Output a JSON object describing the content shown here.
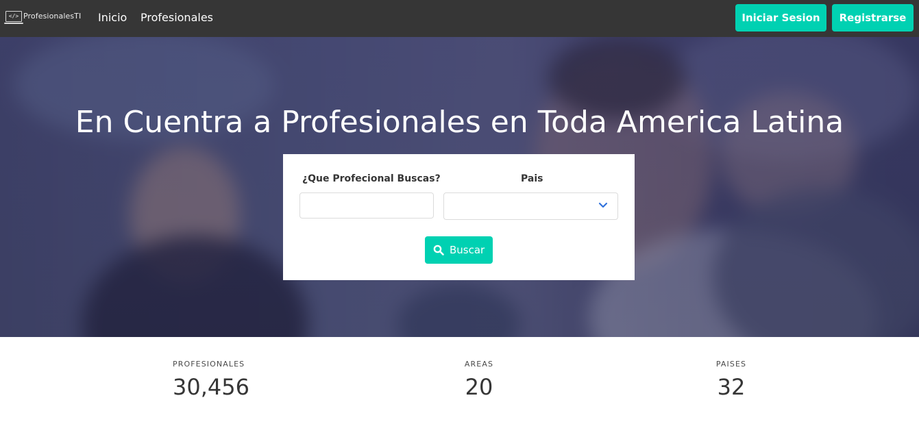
{
  "navbar": {
    "logo_text": "ProfesionalesTI",
    "logo_glyph": "</>",
    "links": [
      "Inicio",
      "Profesionales"
    ],
    "login_label": "Iniciar Sesion",
    "register_label": "Registrarse",
    "bg_color": "#363636",
    "accent_color": "#00d1b2"
  },
  "hero": {
    "title": "En Cuentra a Profesionales en Toda America Latina"
  },
  "search": {
    "profession_label": "¿Que Profecional Buscas?",
    "profession_value": "",
    "country_label": "Pais",
    "country_selected": "",
    "button_label": "Buscar",
    "button_icon": "search-icon",
    "select_icon": "chevron-down-icon"
  },
  "stats": [
    {
      "heading": "PROFESIONALES",
      "value": "30,456"
    },
    {
      "heading": "AREAS",
      "value": "20"
    },
    {
      "heading": "PAISES",
      "value": "32"
    }
  ]
}
